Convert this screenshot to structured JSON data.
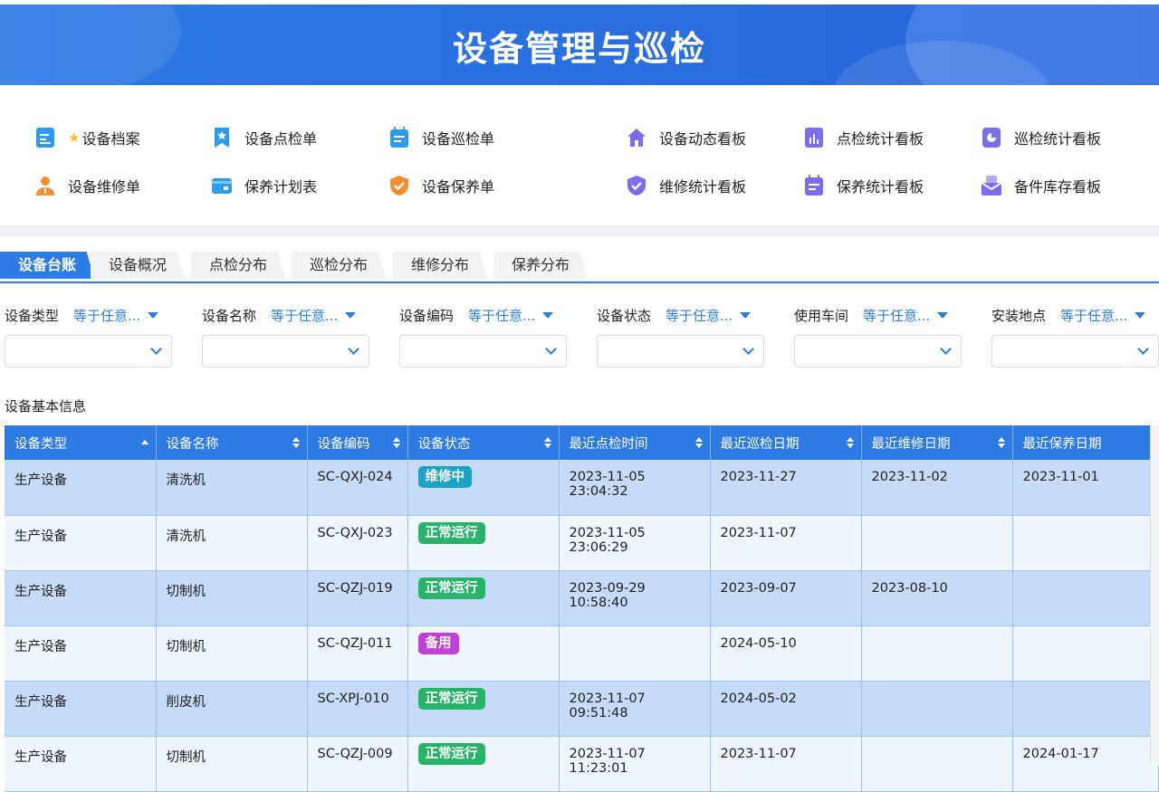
{
  "header": {
    "title": "设备管理与巡检"
  },
  "quick_links": [
    {
      "label": "设备档案",
      "starred": true,
      "icon": "document-icon",
      "color": "#2d9bf0"
    },
    {
      "label": "设备点检单",
      "starred": false,
      "icon": "bookmark-star-icon",
      "color": "#2d9bf0"
    },
    {
      "label": "设备巡检单",
      "starred": false,
      "icon": "calendar-list-icon",
      "color": "#2d9bf0"
    },
    {
      "label": "设备动态看板",
      "starred": false,
      "icon": "home-icon",
      "color": "#7b6cf0"
    },
    {
      "label": "点检统计看板",
      "starred": false,
      "icon": "bar-chart-icon",
      "color": "#7b6cf0"
    },
    {
      "label": "巡检统计看板",
      "starred": false,
      "icon": "pie-chart-icon",
      "color": "#7b6cf0"
    },
    {
      "label": "设备维修单",
      "starred": false,
      "icon": "user-icon",
      "color": "#f58c30"
    },
    {
      "label": "保养计划表",
      "starred": false,
      "icon": "card-icon",
      "color": "#2d9bf0"
    },
    {
      "label": "设备保养单",
      "starred": false,
      "icon": "shield-check-icon",
      "color": "#f58c30"
    },
    {
      "label": "维修统计看板",
      "starred": false,
      "icon": "shield-check-icon",
      "color": "#7b6cf0"
    },
    {
      "label": "保养统计看板",
      "starred": false,
      "icon": "calendar-list-icon",
      "color": "#7b6cf0"
    },
    {
      "label": "备件库存看板",
      "starred": false,
      "icon": "inbox-icon",
      "color": "#7b6cf0"
    }
  ],
  "tabs": [
    {
      "label": "设备台账",
      "active": true
    },
    {
      "label": "设备概况",
      "active": false
    },
    {
      "label": "点检分布",
      "active": false
    },
    {
      "label": "巡检分布",
      "active": false
    },
    {
      "label": "维修分布",
      "active": false
    },
    {
      "label": "保养分布",
      "active": false
    }
  ],
  "filters": [
    {
      "name": "设备类型",
      "op": "等于任意...",
      "value": ""
    },
    {
      "name": "设备名称",
      "op": "等于任意...",
      "value": ""
    },
    {
      "name": "设备编码",
      "op": "等于任意...",
      "value": ""
    },
    {
      "name": "设备状态",
      "op": "等于任意...",
      "value": ""
    },
    {
      "name": "使用车间",
      "op": "等于任意...",
      "value": ""
    },
    {
      "name": "安装地点",
      "op": "等于任意...",
      "value": ""
    }
  ],
  "table": {
    "title": "设备基本信息",
    "columns": [
      "设备类型",
      "设备名称",
      "设备编码",
      "设备状态",
      "最近点检时间",
      "最近巡检日期",
      "最近维修日期",
      "最近保养日期"
    ],
    "status_colors": {
      "维修中": "#1aa3c4",
      "正常运行": "#27b36a",
      "备用": "#c040d8"
    },
    "rows": [
      [
        "生产设备",
        "清洗机",
        "SC-QXJ-024",
        "维修中",
        "2023-11-05 23:04:32",
        "2023-11-27",
        "2023-11-02",
        "2023-11-01"
      ],
      [
        "生产设备",
        "清洗机",
        "SC-QXJ-023",
        "正常运行",
        "2023-11-05 23:06:29",
        "2023-11-07",
        "",
        ""
      ],
      [
        "生产设备",
        "切制机",
        "SC-QZJ-019",
        "正常运行",
        "2023-09-29 10:58:40",
        "2023-09-07",
        "2023-08-10",
        ""
      ],
      [
        "生产设备",
        "切制机",
        "SC-QZJ-011",
        "备用",
        "",
        "2024-05-10",
        "",
        ""
      ],
      [
        "生产设备",
        "削皮机",
        "SC-XPJ-010",
        "正常运行",
        "2023-11-07 09:51:48",
        "2024-05-02",
        "",
        ""
      ],
      [
        "生产设备",
        "切制机",
        "SC-QZJ-009",
        "正常运行",
        "2023-11-07 11:23:01",
        "2023-11-07",
        "",
        "2024-01-17"
      ]
    ]
  }
}
